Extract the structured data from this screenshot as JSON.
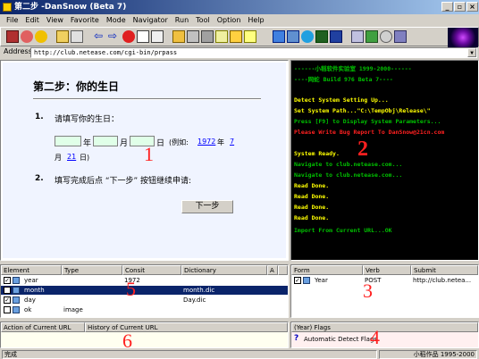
{
  "window": {
    "title": "第二步 -DanSnow (Beta 7)",
    "min": "_",
    "max": "▫",
    "close": "×"
  },
  "menu": [
    "File",
    "Edit",
    "View",
    "Favorite",
    "Mode",
    "Navigator",
    "Run",
    "Tool",
    "Option",
    "Help"
  ],
  "toolbar_icons": [
    "open-icon",
    "stop-icon",
    "settings-icon",
    "folder-icon",
    "refresh-icon",
    "back-icon",
    "forward-icon",
    "stop-red-icon",
    "page-icon",
    "doc-icon",
    "folder-open-icon",
    "save-icon",
    "tools-icon",
    "copy-icon",
    "pencil-icon",
    "note-icon",
    "grid-icon",
    "layout-icon",
    "globe-icon",
    "network-icon",
    "image-icon",
    "monitor-icon",
    "check-icon",
    "toggle-icon",
    "link-icon"
  ],
  "address": {
    "label": "Address",
    "value": "http://club.netease.com/cgi-bin/prpass",
    "dropdown": "▼"
  },
  "page": {
    "heading": "第二步：你的生日",
    "step1_num": "1.",
    "step1_text": "请填写你的生日：",
    "year_unit": "年",
    "month_unit": "月",
    "day_unit": "日",
    "example_prefix": "(例如:",
    "example_year": "1972",
    "example_year_unit": "年",
    "example_month": "7",
    "example_month_unit": "月",
    "example_day": "21",
    "example_day_unit": "日)",
    "step2_num": "2.",
    "step2_text": "填写完成后点 “下一步” 按钮继续申请:",
    "next_button": "下一步"
  },
  "console": {
    "lines": [
      {
        "text": "------小稻软件实验室 1999-2000------",
        "color": "#00c000"
      },
      {
        "text": "----网蛇 Build 976 Beta 7----",
        "color": "#00c000"
      },
      {
        "text": "Detect System Setting Up...",
        "color": "#ffff00"
      },
      {
        "text": "Set System Path...\"C:\\TempObj\\Release\\\"",
        "color": "#ffff00"
      },
      {
        "text": "Press [F9] to Display System Parameters...",
        "color": "#00c000"
      },
      {
        "text": "Please Write Bug Report To DanSnow@21cn.com",
        "color": "#ff2020"
      },
      {
        "text": "System Ready.",
        "color": "#ffff00"
      },
      {
        "text": "Navigate to club.netease.com...",
        "color": "#00c000"
      },
      {
        "text": "Navigate to club.netease.com...",
        "color": "#00c000"
      },
      {
        "text": "Read Done.",
        "color": "#ffff00"
      },
      {
        "text": "Read Done.",
        "color": "#ffff00"
      },
      {
        "text": "Read Done.",
        "color": "#ffff00"
      },
      {
        "text": "Read Done.",
        "color": "#ffff00"
      },
      {
        "text": "Import From Current URL...OK",
        "color": "#00c000"
      }
    ]
  },
  "element_grid": {
    "headers": [
      "Element",
      "Type",
      "Consit",
      "Dictionary",
      "A"
    ],
    "rows": [
      {
        "checked": true,
        "element": "year",
        "type": "",
        "consit": "1972",
        "dictionary": "",
        "selected": false
      },
      {
        "checked": true,
        "element": "month",
        "type": "",
        "consit": "",
        "dictionary": "month.dic",
        "selected": true
      },
      {
        "checked": true,
        "element": "day",
        "type": "",
        "consit": "",
        "dictionary": "Day.dic",
        "selected": false
      },
      {
        "checked": false,
        "element": "ok",
        "type": "image",
        "consit": "",
        "dictionary": "",
        "selected": false
      }
    ]
  },
  "form_grid": {
    "headers": [
      "Form",
      "Verb",
      "Submit"
    ],
    "rows": [
      {
        "checked": true,
        "form": "Year",
        "verb": "POST",
        "submit": "http://club.netea..."
      }
    ]
  },
  "url_panel": {
    "headers": [
      "Action of Current URL",
      "History of Current URL"
    ]
  },
  "flags_panel": {
    "header": "(Year) Flags",
    "icon_text": "?",
    "text": "Automatic Detect Flags"
  },
  "overlay_numbers": [
    "1",
    "2",
    "3",
    "4",
    "5",
    "6"
  ],
  "status": {
    "left": "完成",
    "right": "小稻作品 1995-2000"
  }
}
